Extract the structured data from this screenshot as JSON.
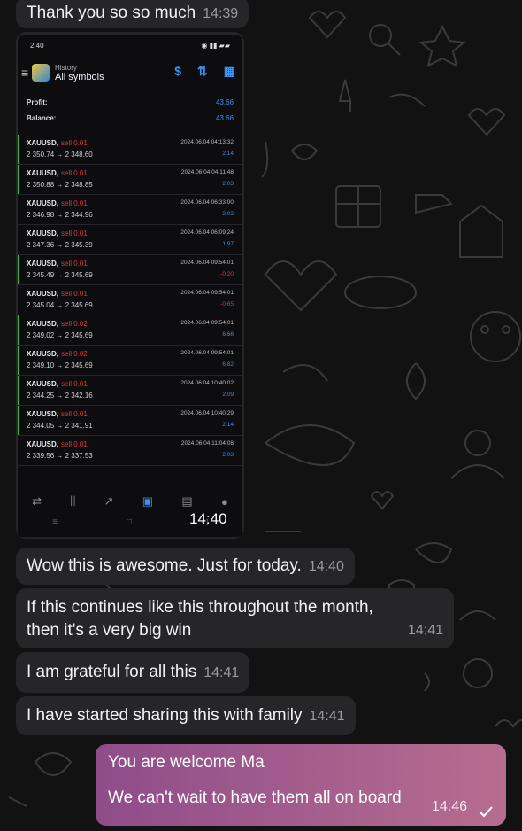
{
  "messages": {
    "m1": {
      "text": "Thank you so so much",
      "time": "14:39"
    },
    "photo_time": "14:40",
    "m2": {
      "text": "Wow this is awesome. Just for today.",
      "time": "14:40"
    },
    "m3": {
      "text": "If this continues like this throughout the month, then it's a very big win",
      "time": "14:41"
    },
    "m4": {
      "text": "I am grateful for all this",
      "time": "14:41"
    },
    "m5": {
      "text": "I have started sharing this with family",
      "time": "14:41"
    },
    "out": {
      "line1": "You are welcome Ma",
      "line2": "We can't wait to have them all on board",
      "time": "14:46"
    }
  },
  "phone": {
    "status_time": "2:40",
    "header_sub": "History",
    "header_title": "All symbols",
    "profit_label": "Profit:",
    "profit_value": "43.66",
    "balance_label": "Balance:",
    "balance_value": "43.66",
    "trades": [
      {
        "symbol": "XAUUSD,",
        "side": "sell 0.01",
        "prices": "2 350.74 → 2 348.60",
        "date": "2024.06.04 04:13:32",
        "pl": "2.14",
        "neg": false,
        "green": true
      },
      {
        "symbol": "XAUUSD,",
        "side": "sell 0.01",
        "prices": "2 350.88 → 2 348.85",
        "date": "2024.06.04 04:11:48",
        "pl": "2.03",
        "neg": false,
        "green": true
      },
      {
        "symbol": "XAUUSD,",
        "side": "sell 0.01",
        "prices": "2 346.98 → 2 344.96",
        "date": "2024.06.04 06:33:00",
        "pl": "2.02",
        "neg": false,
        "green": false
      },
      {
        "symbol": "XAUUSD,",
        "side": "sell 0.01",
        "prices": "2 347.36 → 2 345.39",
        "date": "2024.06.04 06:09:24",
        "pl": "1.97",
        "neg": false,
        "green": false
      },
      {
        "symbol": "XAUUSD,",
        "side": "sell 0.01",
        "prices": "2 345.49 → 2 345.69",
        "date": "2024.06.04 09:54:01",
        "pl": "-0.20",
        "neg": true,
        "green": true
      },
      {
        "symbol": "XAUUSD,",
        "side": "sell 0.01",
        "prices": "2 345.04 → 2 345.69",
        "date": "2024.06.04 09:54:01",
        "pl": "-0.65",
        "neg": true,
        "green": false
      },
      {
        "symbol": "XAUUSD,",
        "side": "sell 0.02",
        "prices": "2 349.02 → 2 345.69",
        "date": "2024.06.04 09:54:01",
        "pl": "6.66",
        "neg": false,
        "green": true
      },
      {
        "symbol": "XAUUSD,",
        "side": "sell 0.02",
        "prices": "2 349.10 → 2 345.69",
        "date": "2024.06.04 09:54:01",
        "pl": "6.82",
        "neg": false,
        "green": true
      },
      {
        "symbol": "XAUUSD,",
        "side": "sell 0.01",
        "prices": "2 344.25 → 2 342.16",
        "date": "2024.06.04 10:40:02",
        "pl": "2.09",
        "neg": false,
        "green": true
      },
      {
        "symbol": "XAUUSD,",
        "side": "sell 0.01",
        "prices": "2 344.05 → 2 341.91",
        "date": "2024.06.04 10:40:29",
        "pl": "2.14",
        "neg": false,
        "green": true
      },
      {
        "symbol": "XAUUSD,",
        "side": "sell 0.01",
        "prices": "2 339.56 → 2 337.53",
        "date": "2024.06.04 11:04:08",
        "pl": "2.03",
        "neg": false,
        "green": false
      }
    ]
  },
  "colors": {
    "bubble": "#262628",
    "accent": "#3d8ff0",
    "sell": "#d9383d",
    "profit_bar": "#4caf50",
    "outgoing_start": "#8e4c8a",
    "outgoing_end": "#b86d8f"
  }
}
